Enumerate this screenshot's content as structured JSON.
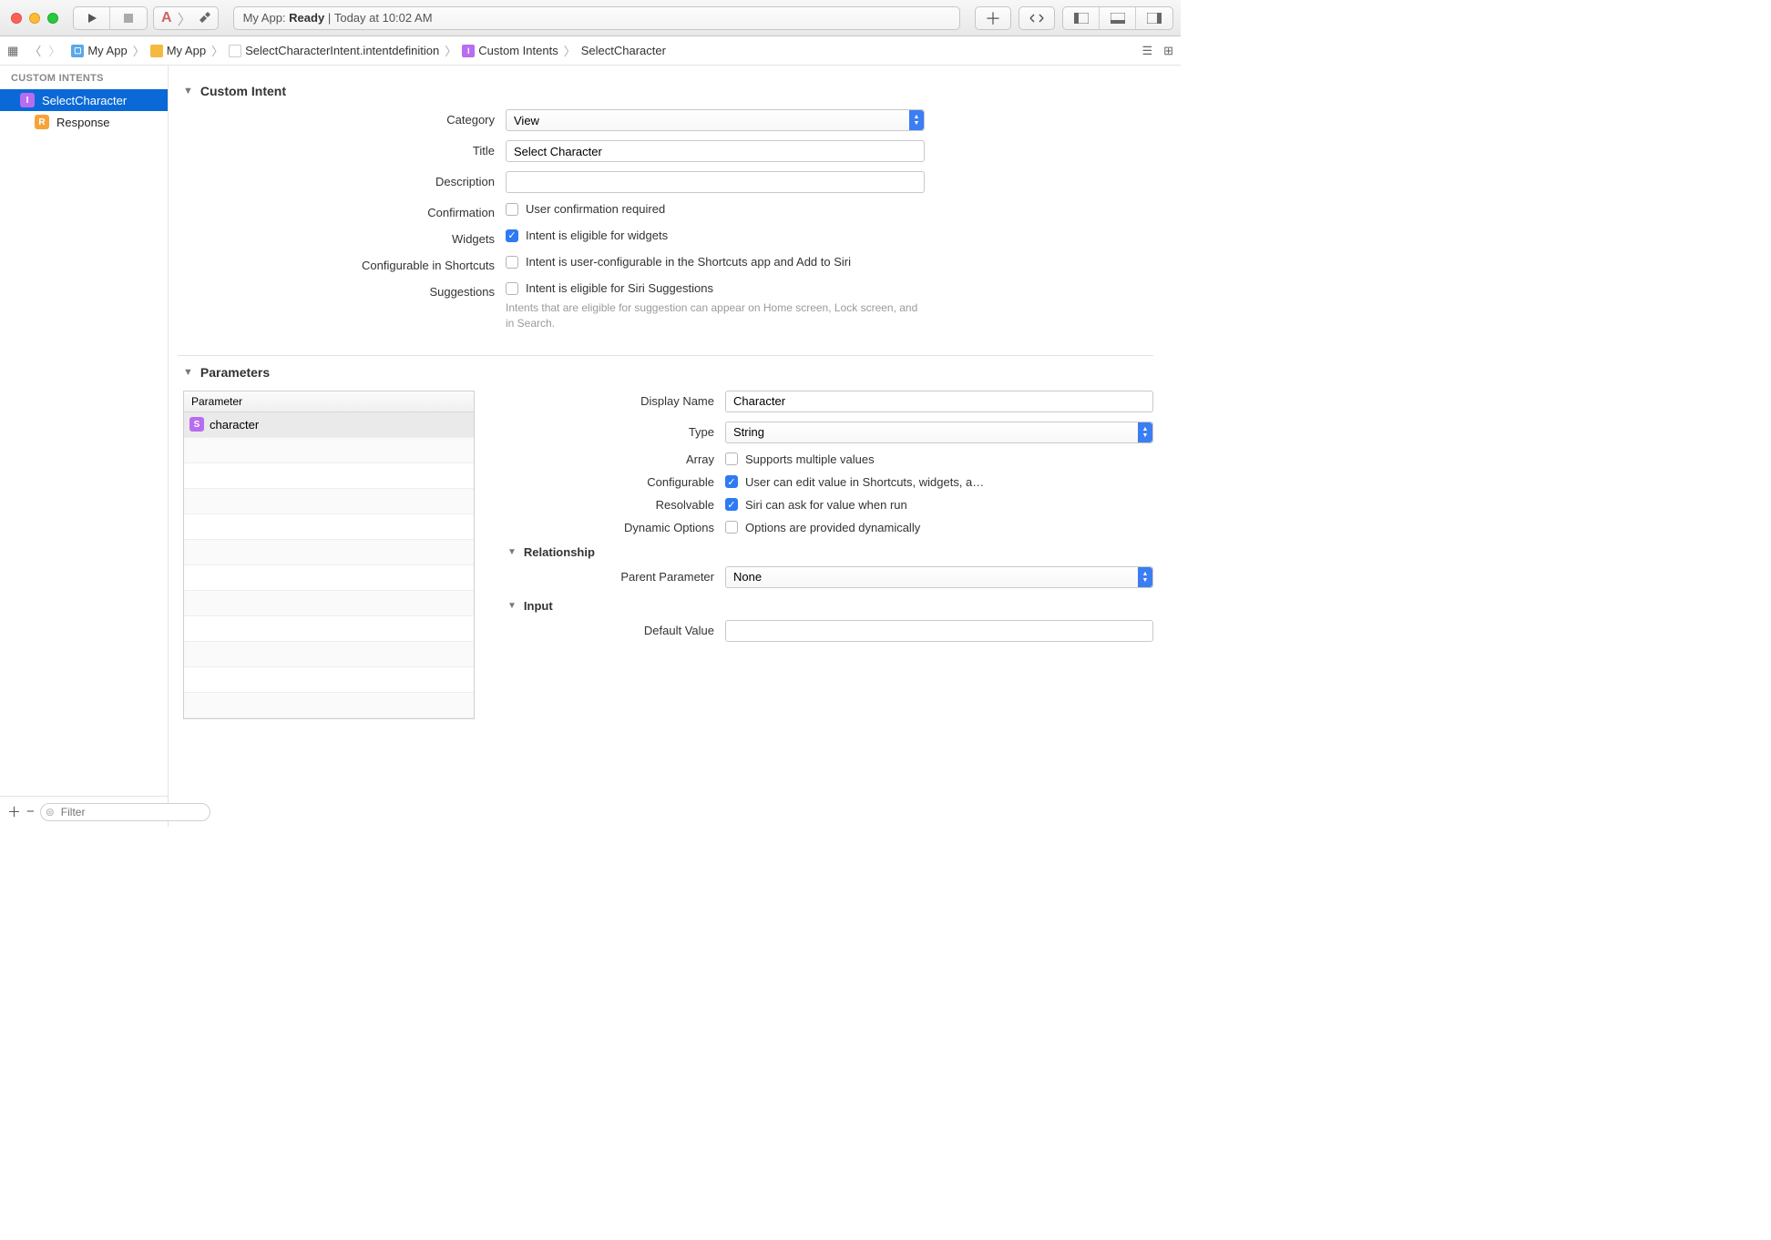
{
  "status": {
    "prefix": "My App:",
    "state": "Ready",
    "sep": "|",
    "time": "Today at 10:02 AM"
  },
  "breadcrumb": {
    "items": [
      "My App",
      "My App",
      "SelectCharacterIntent.intentdefinition",
      "Custom Intents",
      "SelectCharacter"
    ]
  },
  "sidebar": {
    "header": "CUSTOM INTENTS",
    "items": [
      {
        "label": "SelectCharacter",
        "badge": "I"
      },
      {
        "label": "Response",
        "badge": "R"
      }
    ],
    "filter_placeholder": "Filter"
  },
  "intent": {
    "section_title": "Custom Intent",
    "category": {
      "label": "Category",
      "value": "View"
    },
    "title": {
      "label": "Title",
      "value": "Select Character"
    },
    "description": {
      "label": "Description",
      "value": ""
    },
    "confirmation": {
      "label": "Confirmation",
      "text": "User confirmation required",
      "checked": false
    },
    "widgets": {
      "label": "Widgets",
      "text": "Intent is eligible for widgets",
      "checked": true
    },
    "shortcuts": {
      "label": "Configurable in Shortcuts",
      "text": "Intent is user-configurable in the Shortcuts app and Add to Siri",
      "checked": false
    },
    "suggestions": {
      "label": "Suggestions",
      "text": "Intent is eligible for Siri Suggestions",
      "checked": false,
      "hint": "Intents that are eligible for suggestion can appear on Home screen, Lock screen, and in Search."
    }
  },
  "parameters": {
    "section_title": "Parameters",
    "column_header": "Parameter",
    "rows": [
      {
        "name": "character"
      }
    ],
    "details": {
      "display_name": {
        "label": "Display Name",
        "value": "Character"
      },
      "type": {
        "label": "Type",
        "value": "String"
      },
      "array": {
        "label": "Array",
        "text": "Supports multiple values",
        "checked": false
      },
      "configurable": {
        "label": "Configurable",
        "text": "User can edit value in Shortcuts, widgets, a…",
        "checked": true
      },
      "resolvable": {
        "label": "Resolvable",
        "text": "Siri can ask for value when run",
        "checked": true
      },
      "dynamic": {
        "label": "Dynamic Options",
        "text": "Options are provided dynamically",
        "checked": false
      },
      "relationship_title": "Relationship",
      "parent": {
        "label": "Parent Parameter",
        "value": "None"
      },
      "input_title": "Input",
      "default": {
        "label": "Default Value",
        "value": ""
      }
    }
  }
}
